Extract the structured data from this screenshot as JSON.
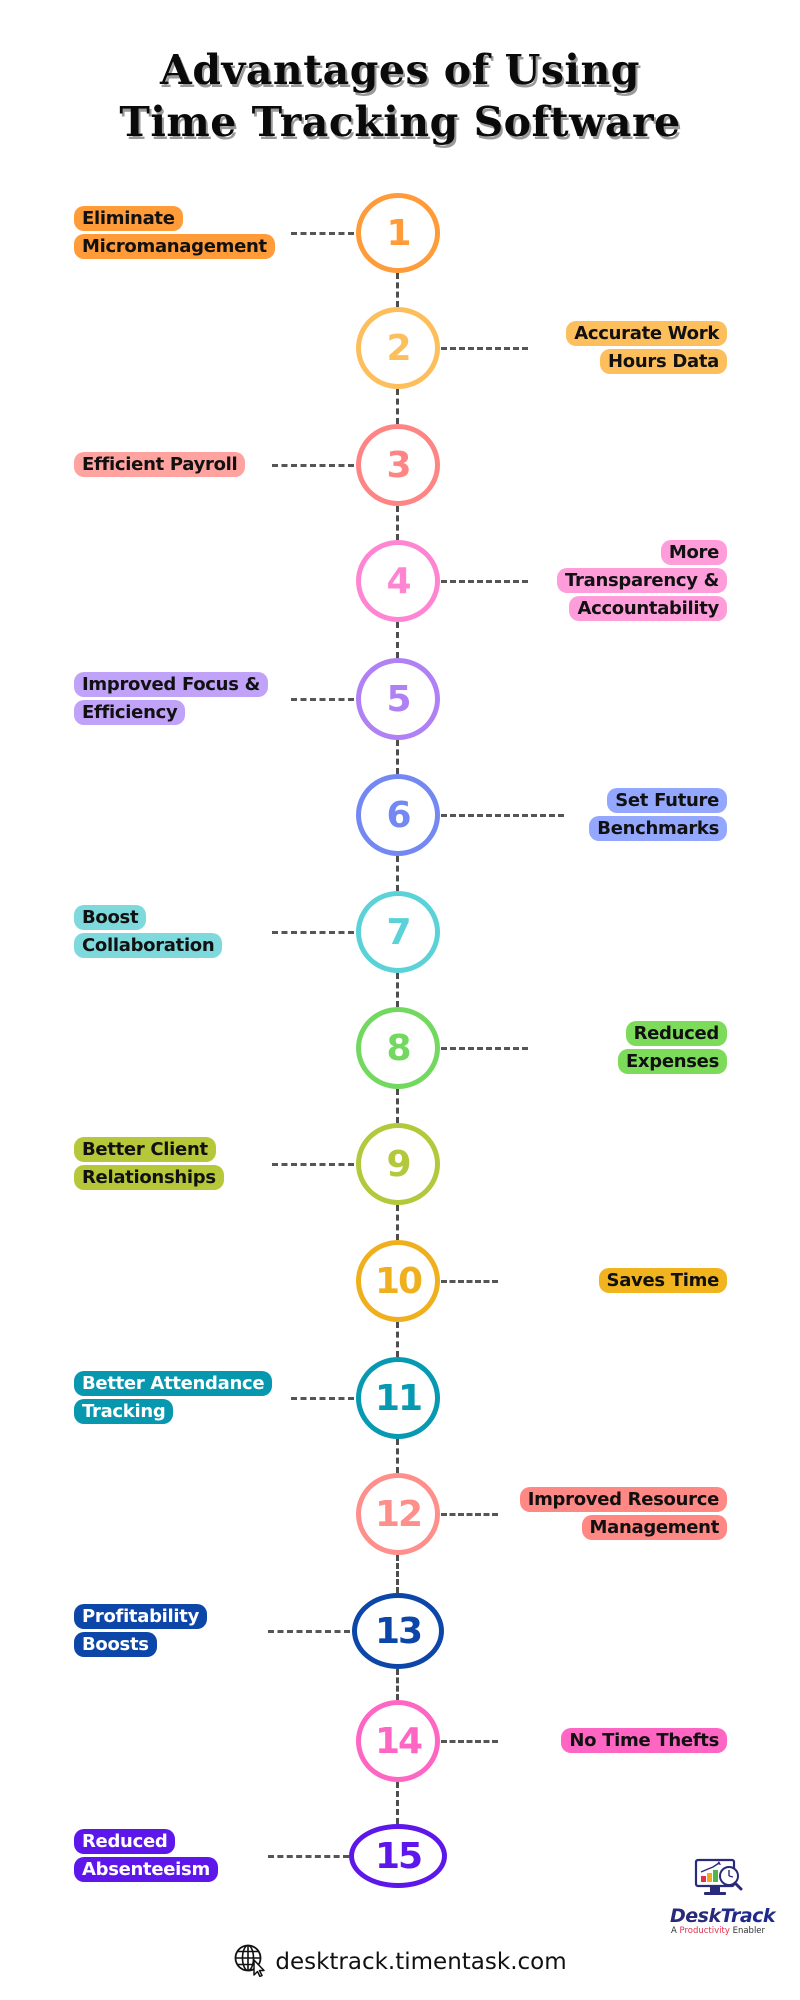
{
  "title": {
    "line1": "Advantages of Using",
    "line2": "Time Tracking Software"
  },
  "items": [
    {
      "number": "1",
      "side": "left",
      "lines": [
        "Eliminate",
        "Micromanagement"
      ],
      "pill_color": "#FF9B38",
      "circle_color": "#FF9B38",
      "text_color": "#111111"
    },
    {
      "number": "2",
      "side": "right",
      "lines": [
        "Accurate Work",
        "Hours Data"
      ],
      "pill_color": "#FDBE5C",
      "circle_color": "#FDBE5C",
      "text_color": "#111111"
    },
    {
      "number": "3",
      "side": "left",
      "lines": [
        "Efficient Payroll"
      ],
      "pill_color": "#FFA3A0",
      "circle_color": "#FF8585",
      "text_color": "#111111"
    },
    {
      "number": "4",
      "side": "right",
      "lines": [
        "More",
        "Transparency &",
        "Accountability"
      ],
      "pill_color": "#FF9DDA",
      "circle_color": "#FF85D3",
      "text_color": "#111111"
    },
    {
      "number": "5",
      "side": "left",
      "lines": [
        "Improved Focus &",
        "Efficiency"
      ],
      "pill_color": "#C0A2F8",
      "circle_color": "#B081F5",
      "text_color": "#111111"
    },
    {
      "number": "6",
      "side": "right",
      "lines": [
        "Set Future",
        "Benchmarks"
      ],
      "pill_color": "#94A7FF",
      "circle_color": "#7388F2",
      "text_color": "#111111"
    },
    {
      "number": "7",
      "side": "left",
      "lines": [
        "Boost",
        "Collaboration"
      ],
      "pill_color": "#7ED9DC",
      "circle_color": "#5AD2D8",
      "text_color": "#111111"
    },
    {
      "number": "8",
      "side": "right",
      "lines": [
        "Reduced",
        "Expenses"
      ],
      "pill_color": "#7DDB5A",
      "circle_color": "#73D85F",
      "text_color": "#111111"
    },
    {
      "number": "9",
      "side": "left",
      "lines": [
        "Better Client",
        "Relationships"
      ],
      "pill_color": "#B6C73A",
      "circle_color": "#B3C83A",
      "text_color": "#111111"
    },
    {
      "number": "10",
      "side": "right",
      "lines": [
        "Saves Time"
      ],
      "pill_color": "#F2B41E",
      "circle_color": "#F0B01E",
      "text_color": "#111111"
    },
    {
      "number": "11",
      "side": "left",
      "lines": [
        "Better Attendance",
        "Tracking"
      ],
      "pill_color": "#0797AF",
      "circle_color": "#0799B1",
      "text_color": "#FFFFFF"
    },
    {
      "number": "12",
      "side": "right",
      "lines": [
        "Improved Resource",
        "Management"
      ],
      "pill_color": "#FF8784",
      "circle_color": "#FF8F8A",
      "text_color": "#111111"
    },
    {
      "number": "13",
      "side": "left",
      "lines": [
        "Profitability",
        "Boosts"
      ],
      "pill_color": "#0C46A8",
      "circle_color": "#0C46A8",
      "text_color": "#FFFFFF"
    },
    {
      "number": "14",
      "side": "right",
      "lines": [
        "No Time Thefts"
      ],
      "pill_color": "#FF66C4",
      "circle_color": "#FF66C4",
      "text_color": "#111111"
    },
    {
      "number": "15",
      "side": "left",
      "lines": [
        "Reduced",
        "Absenteeism"
      ],
      "pill_color": "#5E17EB",
      "circle_color": "#5E17EB",
      "text_color": "#FFFFFF"
    }
  ],
  "footer": {
    "icon": "globe-cursor-icon",
    "url": "desktrack.timentask.com"
  },
  "logo": {
    "icon": "monitor-chart-clock-icon",
    "name_part1": "Desk",
    "name_part2": "Track",
    "tagline_part1": "A ",
    "tagline_part2": "Productivity",
    "tagline_part3": " Enabler"
  }
}
